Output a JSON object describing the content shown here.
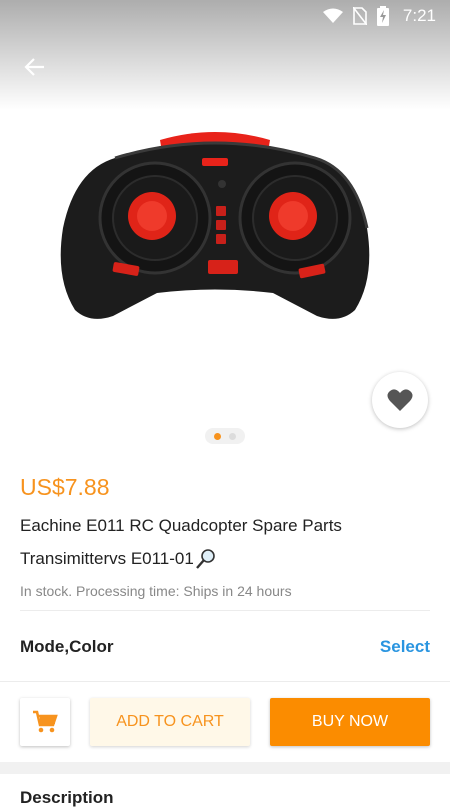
{
  "status_bar": {
    "time": "7:21",
    "icons": [
      "wifi-icon",
      "no-sim-icon",
      "battery-charging-icon"
    ]
  },
  "navigation": {
    "back_icon": "arrow-left-icon"
  },
  "gallery": {
    "image_subject": "black RC transmitter with red joysticks",
    "page_count": 2,
    "active_index": 0,
    "favorite_icon": "heart-icon"
  },
  "product": {
    "price": "US$7.88",
    "title_line1": "Eachine E011 RC Quadcopter Spare Parts",
    "title_line2": "Transimittervs E011-01",
    "title_icon": "magnifier-icon",
    "stock_text": "In stock. Processing time: Ships in 24 hours"
  },
  "options": {
    "label": "Mode,Color",
    "select_label": "Select"
  },
  "actions": {
    "cart_icon": "shopping-cart-icon",
    "add_to_cart": "ADD TO CART",
    "buy_now": "BUY NOW"
  },
  "description": {
    "heading": "Description"
  },
  "colors": {
    "accent_orange": "#f7931e",
    "buy_button": "#fb8c00",
    "link_blue": "#2a95e0"
  }
}
